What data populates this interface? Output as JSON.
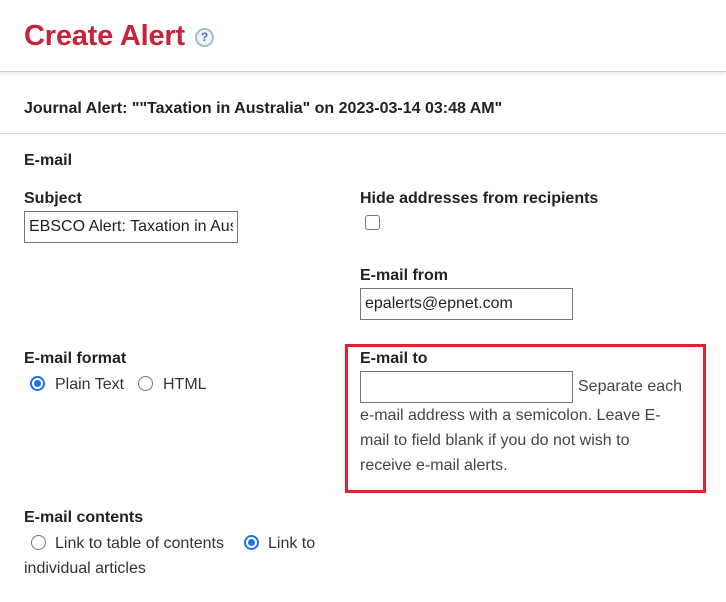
{
  "header": {
    "title": "Create Alert",
    "help_icon": "?"
  },
  "alert": {
    "description": "Journal Alert: \"\"Taxation in Australia\" on 2023-03-14 03:48 AM\""
  },
  "email_section": {
    "label": "E-mail",
    "subject_label": "Subject",
    "subject_value": "EBSCO Alert: Taxation in Australia",
    "hide_addresses_label": "Hide addresses from recipients",
    "hide_addresses_checked": false,
    "from_label": "E-mail from",
    "from_value": "epalerts@epnet.com",
    "format_label": "E-mail format",
    "format_options": [
      {
        "label": "Plain Text",
        "selected": true
      },
      {
        "label": "HTML",
        "selected": false
      }
    ],
    "to_label": "E-mail to",
    "to_value": "",
    "to_hint_line1": "Separate each",
    "to_hint_line2": "e-mail address with a semicolon. Leave E-",
    "to_hint_line3": "mail to field blank if you do not wish to",
    "to_hint_line4": "receive e-mail alerts.",
    "contents_label": "E-mail contents",
    "contents_options": [
      {
        "label": "Link to table of contents",
        "selected": false
      },
      {
        "label": "Link to",
        "selected": true
      }
    ],
    "contents_wrap_text": "individual articles"
  },
  "colors": {
    "title": "#c6243a",
    "highlight_border": "#e0202e",
    "radio_selected": "#1a73e8"
  }
}
